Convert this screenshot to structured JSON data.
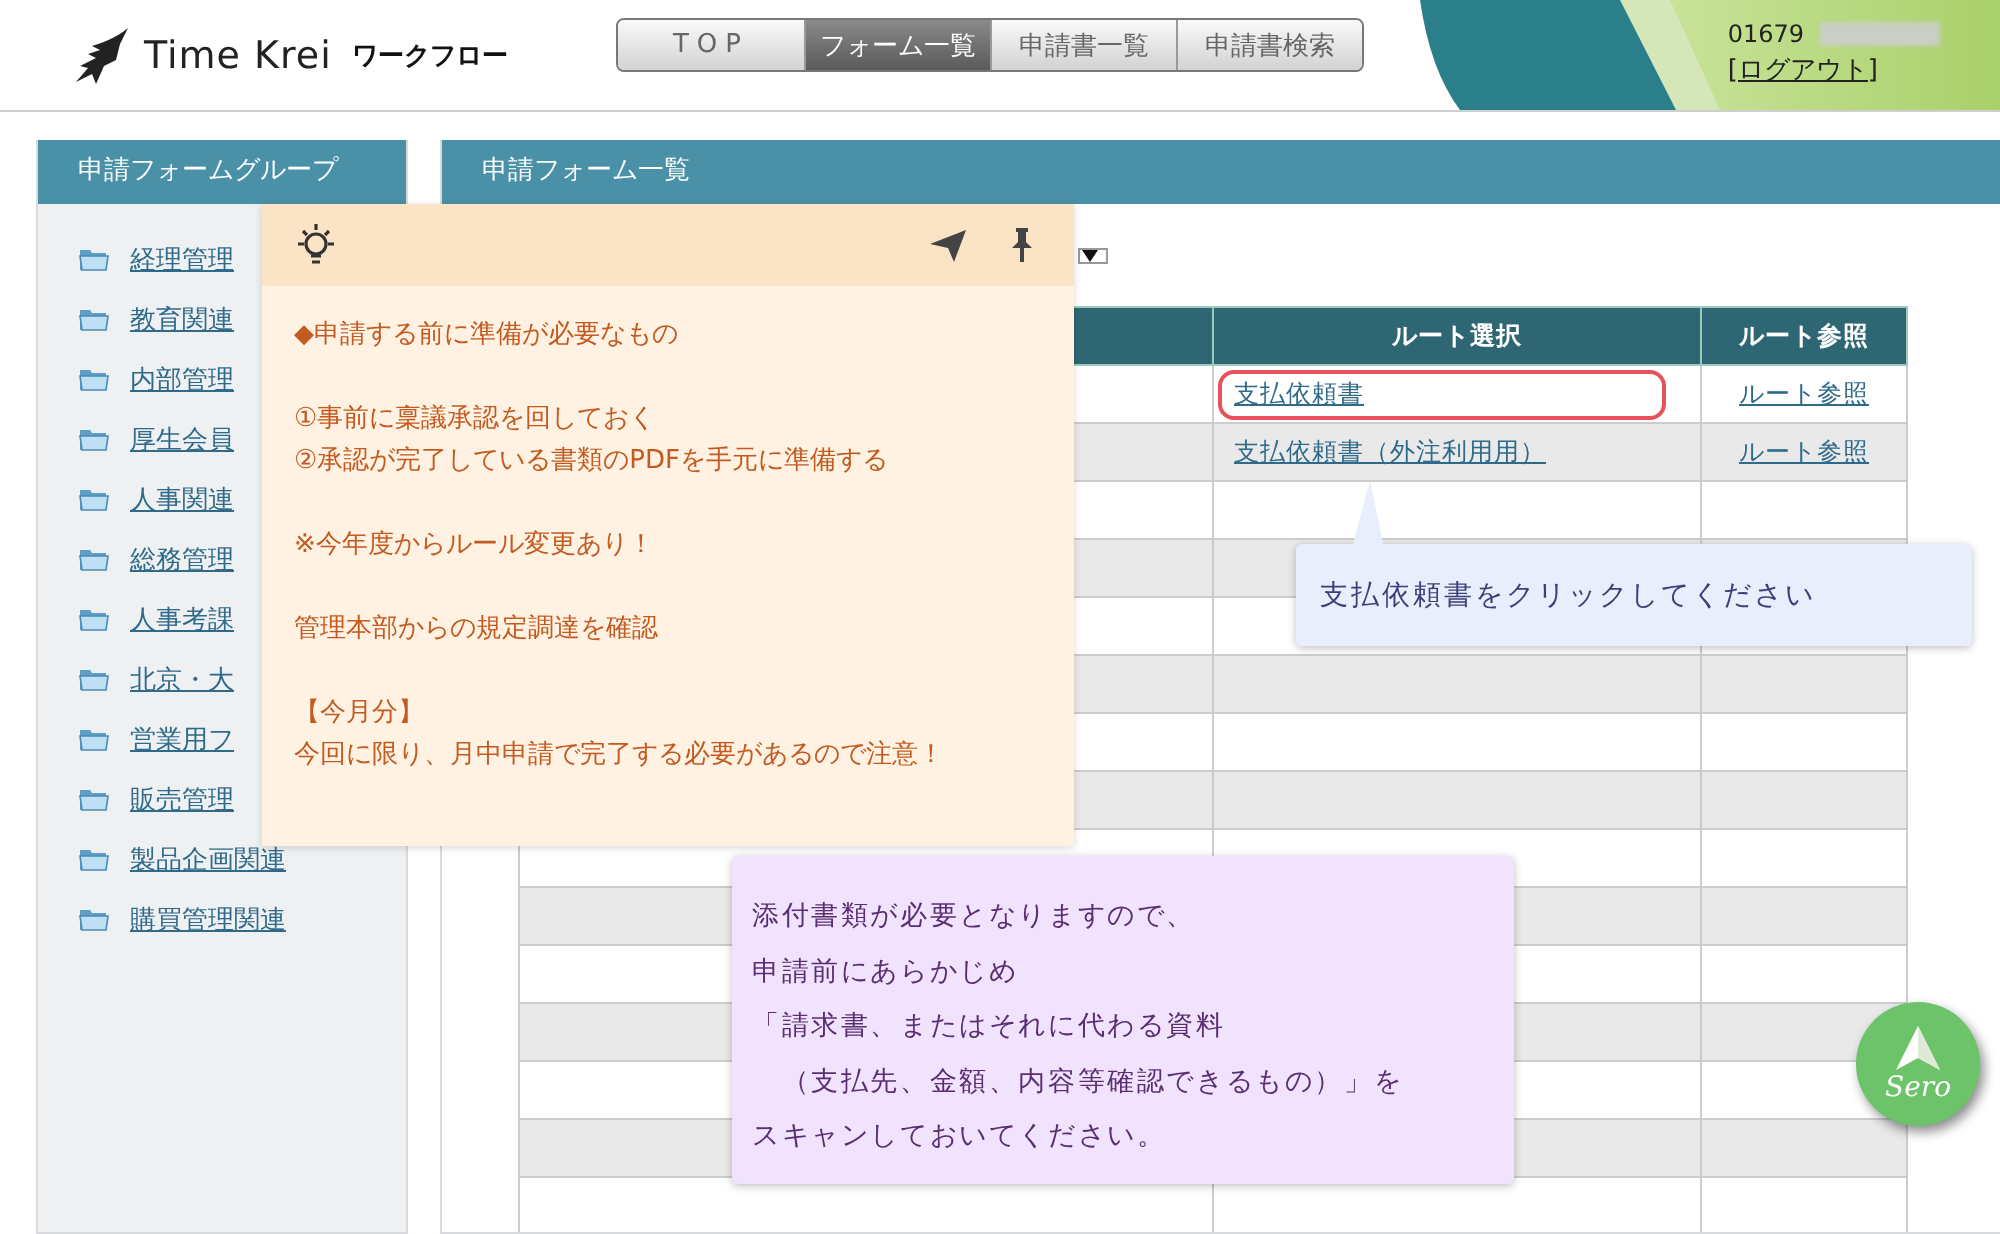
{
  "header": {
    "logo_text": "Time Krei",
    "logo_suffix": "ワークフロー",
    "nav": [
      {
        "label": "TOP",
        "selected": false
      },
      {
        "label": "フォーム一覧",
        "selected": true
      },
      {
        "label": "申請書一覧",
        "selected": false
      },
      {
        "label": "申請書検索",
        "selected": false
      }
    ],
    "user_id": "01679",
    "logout": "[ログアウト]"
  },
  "sidebar": {
    "title": "申請フォームグループ",
    "items": [
      "経理管理",
      "教育関連",
      "内部管理",
      "厚生会員",
      "人事関連",
      "総務管理",
      "人事考課",
      "北京・大",
      "営業用フ",
      "販売管理",
      "製品企画関連",
      "購買管理関連"
    ]
  },
  "main": {
    "title": "申請フォーム一覧",
    "table": {
      "columns": [
        "ルート選択",
        "ルート参照"
      ],
      "rows": [
        {
          "route": "支払依頼書",
          "route_ref": "ルート参照",
          "highlighted": true
        },
        {
          "route": "支払依頼書（外注利用用）",
          "route_ref": "ルート参照",
          "highlighted": false
        }
      ]
    }
  },
  "note": {
    "paragraphs": [
      [
        "◆申請する前に準備が必要なもの"
      ],
      [
        "①事前に稟議承認を回しておく",
        "②承認が完了している書類のPDFを手元に準備する"
      ],
      [
        "※今年度からルール変更あり！"
      ],
      [
        "管理本部からの規定調達を確認"
      ],
      [
        "【今月分】",
        "今回に限り、月中申請で完了する必要があるので注意！"
      ]
    ]
  },
  "click_hint": {
    "text": "支払依頼書をクリックしてください"
  },
  "attach_hint": {
    "lines": [
      "添付書類が必要となりますので、",
      "申請前にあらかじめ",
      "「請求書、またはそれに代わる資料",
      "　（支払先、金額、内容等確認できるもの）」を",
      "スキャンしておいてください。"
    ]
  },
  "sero": {
    "label": "Sero"
  }
}
